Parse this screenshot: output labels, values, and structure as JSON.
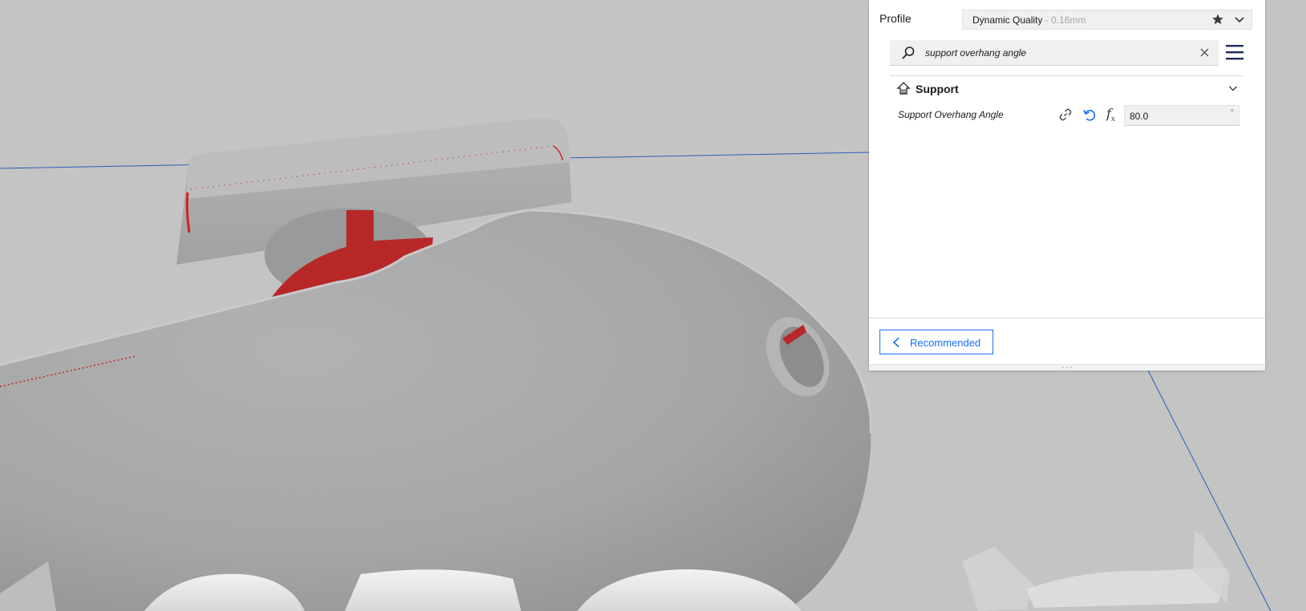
{
  "profile": {
    "label": "Profile",
    "name": "Dynamic Quality",
    "layer_height": " - 0.16mm",
    "favorite_icon": "star-icon",
    "dropdown_icon": "chevron-down-icon"
  },
  "search": {
    "value": "support overhang angle",
    "icon": "search-icon",
    "clear_icon": "close-icon"
  },
  "settings_menu_icon": "hamburger-menu-icon",
  "category": {
    "title": "Support",
    "icon": "support-icon",
    "expand_icon": "chevron-down-icon"
  },
  "setting": {
    "label": "Support Overhang Angle",
    "value": "80.0",
    "unit": "°",
    "icons": [
      "link-icon",
      "reset-icon",
      "function-icon"
    ]
  },
  "footer": {
    "recommended_label": "Recommended",
    "back_icon": "chevron-left-icon"
  },
  "colors": {
    "accent": "#196ef0",
    "overhang": "#b82828",
    "model": "#a9a9a9",
    "viewport_background": "#c4c4c4",
    "build_volume_line": "#2a5fb8"
  }
}
